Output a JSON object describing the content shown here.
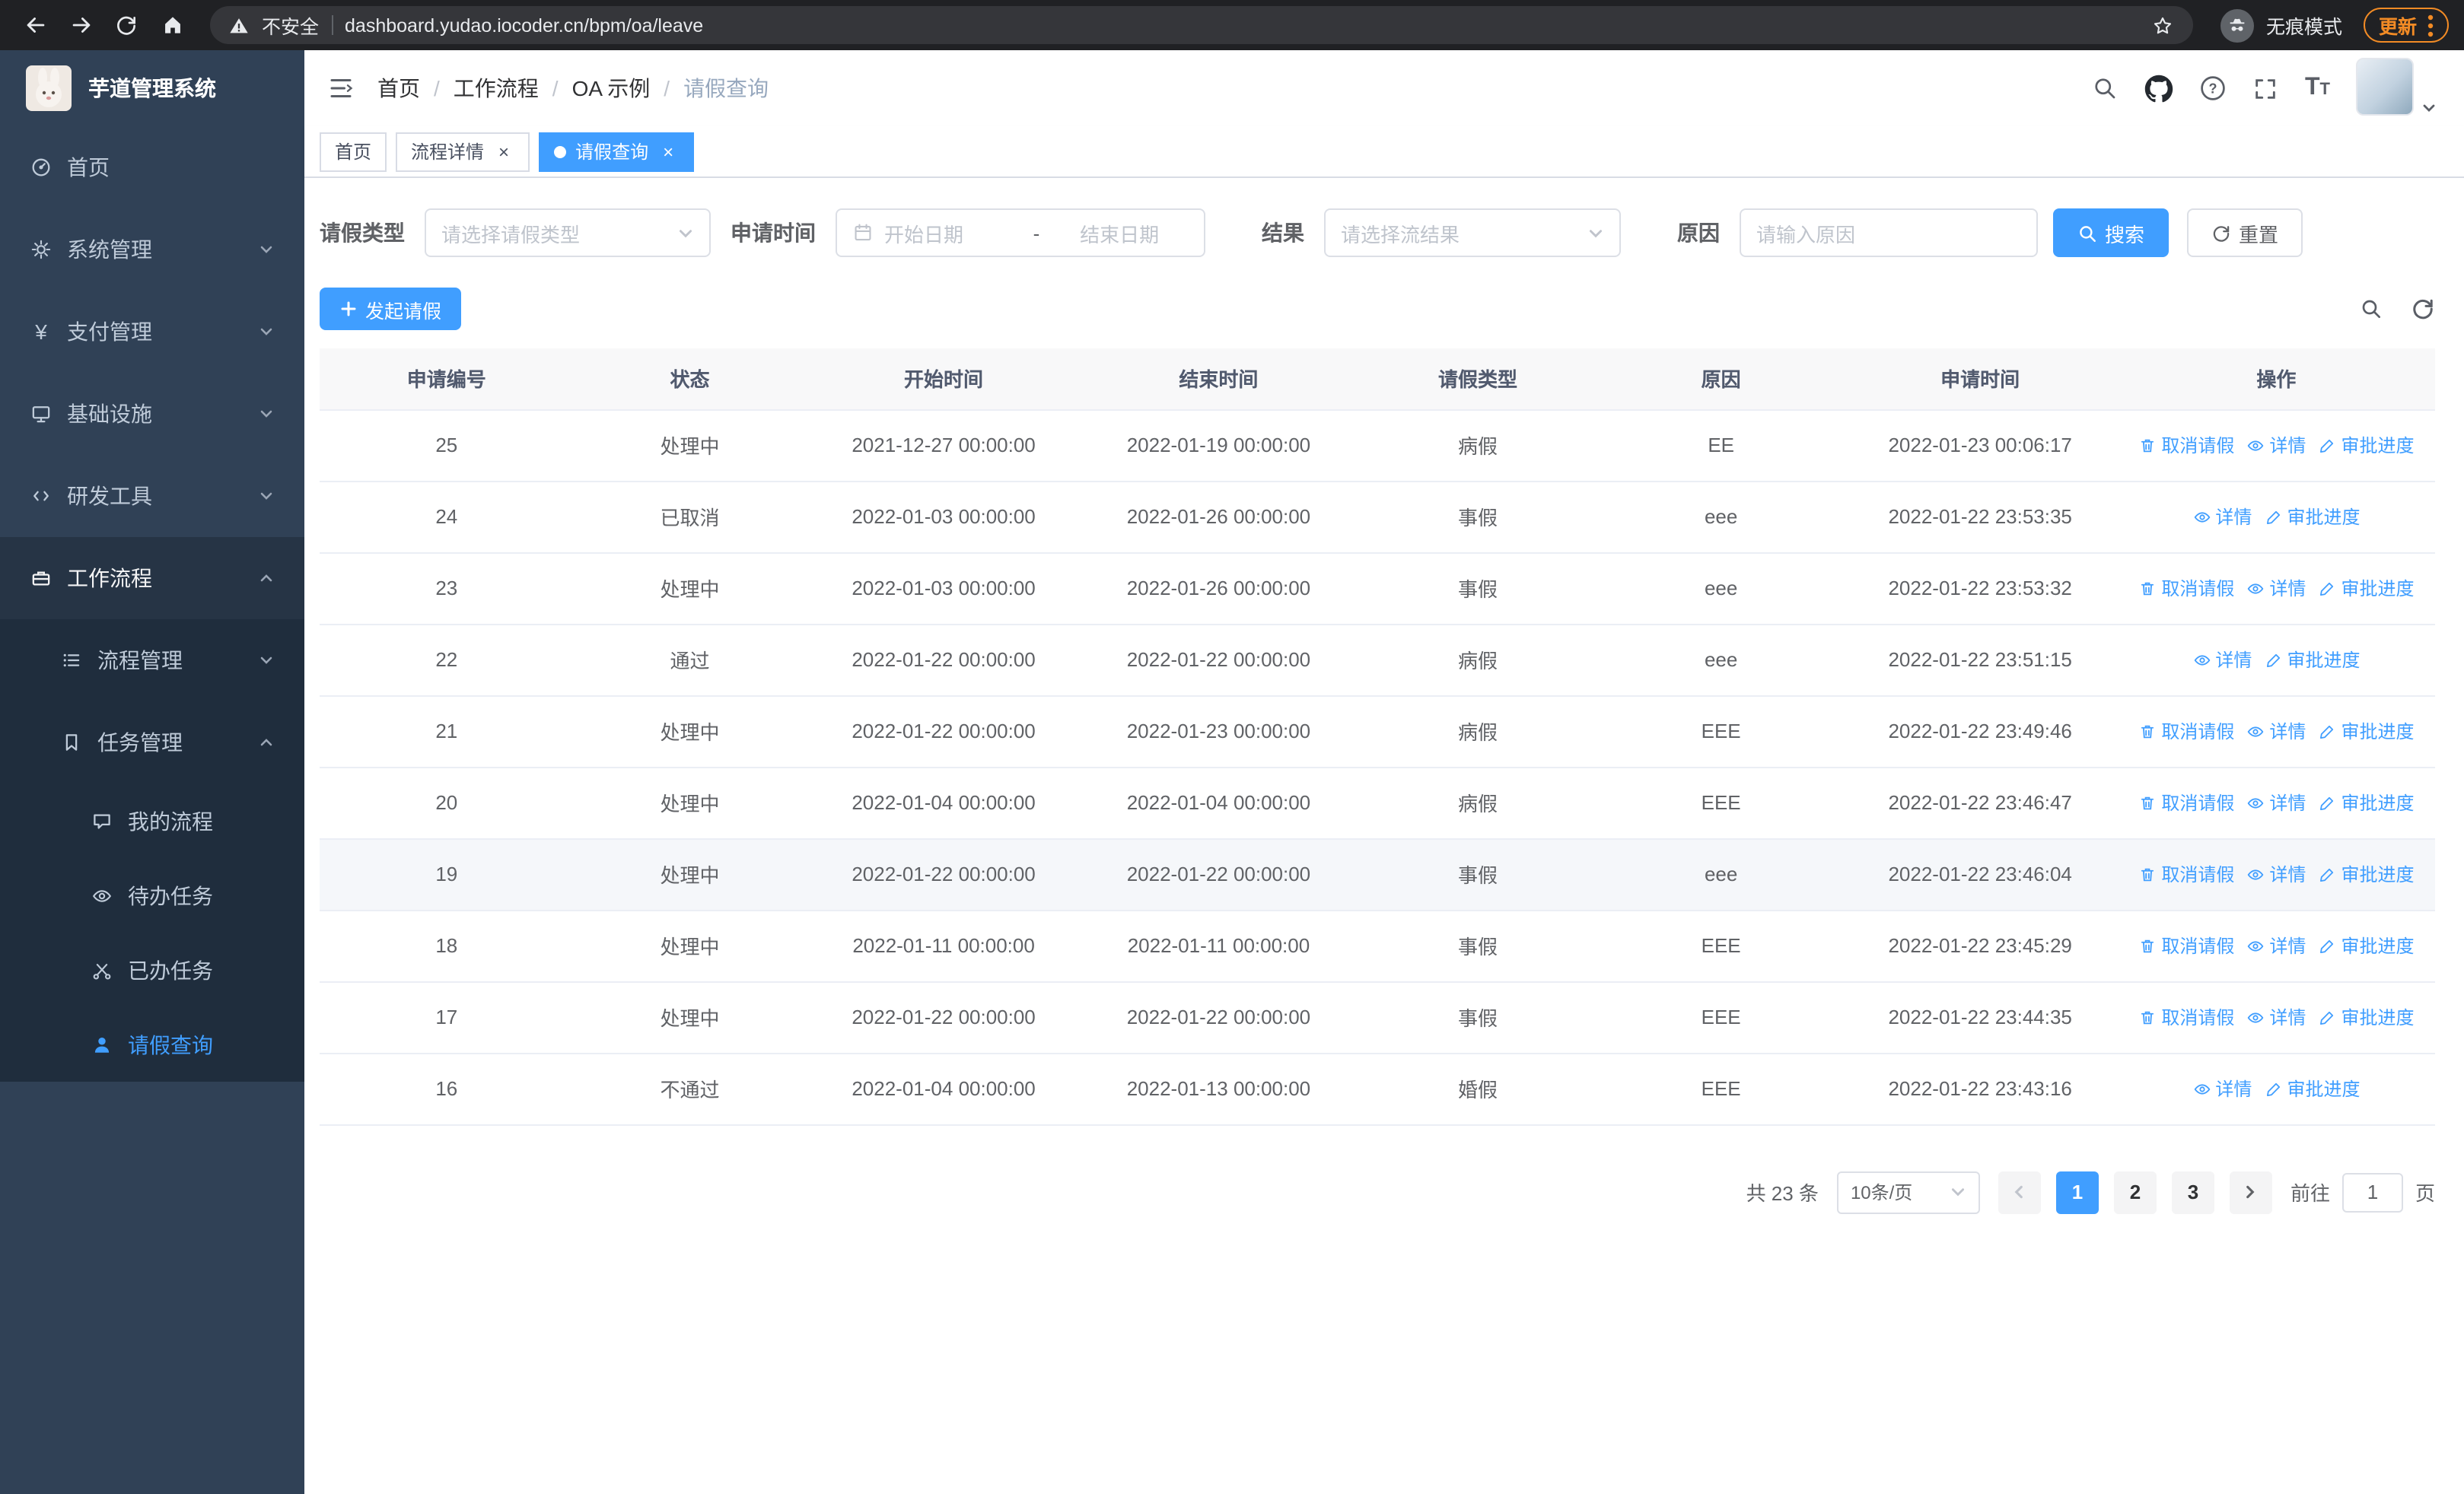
{
  "browser": {
    "security_label": "不安全",
    "url": "dashboard.yudao.iocoder.cn/bpm/oa/leave",
    "incognito_label": "无痕模式",
    "update_label": "更新"
  },
  "sidebar": {
    "app_title": "芋道管理系统",
    "menu": {
      "home": "首页",
      "system": "系统管理",
      "payment": "支付管理",
      "infra": "基础设施",
      "devtools": "研发工具",
      "workflow": "工作流程",
      "process_mgmt": "流程管理",
      "task_mgmt": "任务管理",
      "my_process": "我的流程",
      "todo_tasks": "待办任务",
      "done_tasks": "已办任务",
      "leave_query": "请假查询"
    }
  },
  "header": {
    "breadcrumb": [
      "首页",
      "工作流程",
      "OA 示例",
      "请假查询"
    ],
    "separator": "/"
  },
  "tabs": [
    {
      "label": "首页",
      "closable": false,
      "active": false
    },
    {
      "label": "流程详情",
      "closable": true,
      "active": false
    },
    {
      "label": "请假查询",
      "closable": true,
      "active": true
    }
  ],
  "filters": {
    "leave_type": {
      "label": "请假类型",
      "placeholder": "请选择请假类型"
    },
    "apply_time": {
      "label": "申请时间",
      "start_placeholder": "开始日期",
      "separator": "-",
      "end_placeholder": "结束日期"
    },
    "result": {
      "label": "结果",
      "placeholder": "请选择流结果"
    },
    "reason": {
      "label": "原因",
      "placeholder": "请输入原因"
    },
    "search_label": "搜索",
    "reset_label": "重置"
  },
  "toolbar": {
    "create_label": "发起请假"
  },
  "table": {
    "columns": [
      "申请编号",
      "状态",
      "开始时间",
      "结束时间",
      "请假类型",
      "原因",
      "申请时间",
      "操作"
    ],
    "action_labels": {
      "cancel": "取消请假",
      "detail": "详情",
      "progress": "审批进度"
    },
    "rows": [
      {
        "id": "25",
        "status": "处理中",
        "start": "2021-12-27 00:00:00",
        "end": "2022-01-19 00:00:00",
        "type": "病假",
        "reason": "EE",
        "apply_time": "2022-01-23 00:06:17",
        "actions": [
          "cancel",
          "detail",
          "progress"
        ],
        "highlight": false
      },
      {
        "id": "24",
        "status": "已取消",
        "start": "2022-01-03 00:00:00",
        "end": "2022-01-26 00:00:00",
        "type": "事假",
        "reason": "eee",
        "apply_time": "2022-01-22 23:53:35",
        "actions": [
          "detail",
          "progress"
        ],
        "highlight": false
      },
      {
        "id": "23",
        "status": "处理中",
        "start": "2022-01-03 00:00:00",
        "end": "2022-01-26 00:00:00",
        "type": "事假",
        "reason": "eee",
        "apply_time": "2022-01-22 23:53:32",
        "actions": [
          "cancel",
          "detail",
          "progress"
        ],
        "highlight": false
      },
      {
        "id": "22",
        "status": "通过",
        "start": "2022-01-22 00:00:00",
        "end": "2022-01-22 00:00:00",
        "type": "病假",
        "reason": "eee",
        "apply_time": "2022-01-22 23:51:15",
        "actions": [
          "detail",
          "progress"
        ],
        "highlight": false
      },
      {
        "id": "21",
        "status": "处理中",
        "start": "2022-01-22 00:00:00",
        "end": "2022-01-23 00:00:00",
        "type": "病假",
        "reason": "EEE",
        "apply_time": "2022-01-22 23:49:46",
        "actions": [
          "cancel",
          "detail",
          "progress"
        ],
        "highlight": false
      },
      {
        "id": "20",
        "status": "处理中",
        "start": "2022-01-04 00:00:00",
        "end": "2022-01-04 00:00:00",
        "type": "病假",
        "reason": "EEE",
        "apply_time": "2022-01-22 23:46:47",
        "actions": [
          "cancel",
          "detail",
          "progress"
        ],
        "highlight": false
      },
      {
        "id": "19",
        "status": "处理中",
        "start": "2022-01-22 00:00:00",
        "end": "2022-01-22 00:00:00",
        "type": "事假",
        "reason": "eee",
        "apply_time": "2022-01-22 23:46:04",
        "actions": [
          "cancel",
          "detail",
          "progress"
        ],
        "highlight": true
      },
      {
        "id": "18",
        "status": "处理中",
        "start": "2022-01-11 00:00:00",
        "end": "2022-01-11 00:00:00",
        "type": "事假",
        "reason": "EEE",
        "apply_time": "2022-01-22 23:45:29",
        "actions": [
          "cancel",
          "detail",
          "progress"
        ],
        "highlight": false
      },
      {
        "id": "17",
        "status": "处理中",
        "start": "2022-01-22 00:00:00",
        "end": "2022-01-22 00:00:00",
        "type": "事假",
        "reason": "EEE",
        "apply_time": "2022-01-22 23:44:35",
        "actions": [
          "cancel",
          "detail",
          "progress"
        ],
        "highlight": false
      },
      {
        "id": "16",
        "status": "不通过",
        "start": "2022-01-04 00:00:00",
        "end": "2022-01-13 00:00:00",
        "type": "婚假",
        "reason": "EEE",
        "apply_time": "2022-01-22 23:43:16",
        "actions": [
          "detail",
          "progress"
        ],
        "highlight": false
      }
    ]
  },
  "pagination": {
    "total_label": "共 23 条",
    "page_size": "10条/页",
    "pages": [
      "1",
      "2",
      "3"
    ],
    "active_page": "1",
    "goto_label": "前往",
    "goto_value": "1",
    "goto_suffix": "页"
  },
  "colors": {
    "primary": "#409eff",
    "sidebar_bg": "#304156",
    "submenu_bg": "#1f2d3d",
    "update_chip": "#f28b25"
  }
}
